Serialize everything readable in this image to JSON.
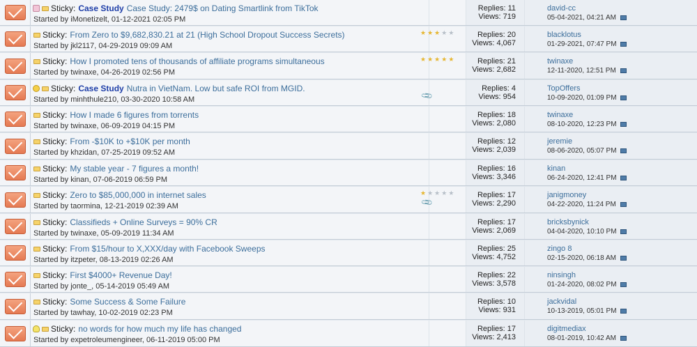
{
  "threads": [
    {
      "pre_icon": "pink",
      "sticky": "Sticky:",
      "prefix": "Case Study",
      "title": "Case Study: 2479$ on Dating Smartlink from TikTok",
      "starter": "Started by iMonetizelt, 01-12-2021 02:05 PM",
      "rating": 0,
      "attachment": false,
      "replies": "Replies: 11",
      "views": "Views: 719",
      "last_user": "david-cc",
      "last_date": "05-04-2021,",
      "last_time": "04:21 AM"
    },
    {
      "pre_icon": "",
      "sticky": "Sticky:",
      "prefix": "",
      "title": "From Zero to $9,682,830.21 at 21 (High School Dropout Success Secrets)",
      "starter": "Started by jkl2117, 04-29-2019 09:09 AM",
      "rating": 3,
      "attachment": false,
      "replies": "Replies: 20",
      "views": "Views: 4,067",
      "last_user": "blacklotus",
      "last_date": "01-29-2021,",
      "last_time": "07:47 PM"
    },
    {
      "pre_icon": "",
      "sticky": "Sticky:",
      "prefix": "",
      "title": "How I promoted tens of thousands of affiliate programs simultaneous",
      "starter": "Started by twinaxe, 04-26-2019 02:56 PM",
      "rating": 5,
      "attachment": false,
      "replies": "Replies: 21",
      "views": "Views: 2,682",
      "last_user": "twinaxe",
      "last_date": "12-11-2020,",
      "last_time": "12:51 PM"
    },
    {
      "pre_icon": "smile",
      "sticky": "Sticky:",
      "prefix": "Case Study",
      "title": "Nutra in VietNam. Low but safe ROI from MGID.",
      "starter": "Started by minhthule210, 03-30-2020 10:58 AM",
      "rating": 0,
      "attachment": true,
      "replies": "Replies: 4",
      "views": "Views: 954",
      "last_user": "TopOffers",
      "last_date": "10-09-2020,",
      "last_time": "01:09 PM"
    },
    {
      "pre_icon": "",
      "sticky": "Sticky:",
      "prefix": "",
      "title": "How I made 6 figures from torrents",
      "starter": "Started by twinaxe, 06-09-2019 04:15 PM",
      "rating": 0,
      "attachment": false,
      "replies": "Replies: 18",
      "views": "Views: 2,080",
      "last_user": "twinaxe",
      "last_date": "08-10-2020,",
      "last_time": "12:23 PM"
    },
    {
      "pre_icon": "",
      "sticky": "Sticky:",
      "prefix": "",
      "title": "From -$10K to +$10K per month",
      "starter": "Started by khzidan, 07-25-2019 09:52 AM",
      "rating": 0,
      "attachment": false,
      "replies": "Replies: 12",
      "views": "Views: 2,039",
      "last_user": "jeremie",
      "last_date": "08-06-2020,",
      "last_time": "05:07 PM"
    },
    {
      "pre_icon": "",
      "sticky": "Sticky:",
      "prefix": "",
      "title": "My stable year - 7 figures a month!",
      "starter": "Started by kinan, 07-06-2019 06:59 PM",
      "rating": 0,
      "attachment": false,
      "replies": "Replies: 16",
      "views": "Views: 3,346",
      "last_user": "kinan",
      "last_date": "06-24-2020,",
      "last_time": "12:41 PM"
    },
    {
      "pre_icon": "",
      "sticky": "Sticky:",
      "prefix": "",
      "title": "Zero to $85,000,000 in internet sales",
      "starter": "Started by taormina, 12-21-2019 02:39 AM",
      "rating": 1,
      "attachment": true,
      "replies": "Replies: 17",
      "views": "Views: 2,290",
      "last_user": "janigmoney",
      "last_date": "04-22-2020,",
      "last_time": "11:24 PM"
    },
    {
      "pre_icon": "",
      "sticky": "Sticky:",
      "prefix": "",
      "title": "Classifieds + Online Surveys = 90% CR",
      "starter": "Started by twinaxe, 05-09-2019 11:34 AM",
      "rating": 0,
      "attachment": false,
      "replies": "Replies: 17",
      "views": "Views: 2,069",
      "last_user": "bricksbynick",
      "last_date": "04-04-2020,",
      "last_time": "10:10 PM"
    },
    {
      "pre_icon": "",
      "sticky": "Sticky:",
      "prefix": "",
      "title": "From $15/hour to X,XXX/day with Facebook Sweeps",
      "starter": "Started by itzpeter, 08-13-2019 02:26 AM",
      "rating": 0,
      "attachment": false,
      "replies": "Replies: 25",
      "views": "Views: 4,752",
      "last_user": "zingo 8",
      "last_date": "02-15-2020,",
      "last_time": "06:18 AM"
    },
    {
      "pre_icon": "",
      "sticky": "Sticky:",
      "prefix": "",
      "title": "First $4000+ Revenue Day!",
      "starter": "Started by jonte_, 05-14-2019 05:49 AM",
      "rating": 0,
      "attachment": false,
      "replies": "Replies: 22",
      "views": "Views: 3,578",
      "last_user": "ninsingh",
      "last_date": "01-24-2020,",
      "last_time": "08:02 PM"
    },
    {
      "pre_icon": "",
      "sticky": "Sticky:",
      "prefix": "",
      "title": "Some Success & Some Failure",
      "starter": "Started by tawhay, 10-02-2019 02:23 PM",
      "rating": 0,
      "attachment": false,
      "replies": "Replies: 10",
      "views": "Views: 931",
      "last_user": "jackvidal",
      "last_date": "10-13-2019,",
      "last_time": "05:01 PM"
    },
    {
      "pre_icon": "bulb",
      "sticky": "Sticky:",
      "prefix": "",
      "title": "no words for how much my life has changed",
      "starter": "Started by expetroleumengineer, 06-11-2019 05:00 PM",
      "rating": 0,
      "attachment": false,
      "replies": "Replies: 17",
      "views": "Views: 2,413",
      "last_user": "digitmediax",
      "last_date": "08-01-2019,",
      "last_time": "10:42 AM"
    }
  ],
  "icons": {
    "thread_status": "envelope-icon",
    "folder": "folder-icon",
    "attachment": "paperclip-icon",
    "goto_last": "goto-last-post-icon",
    "star": "star-icon"
  },
  "colors": {
    "title_link": "#3c6e9b",
    "prefix": "#1f3fa8",
    "envelope": "#e57a53",
    "star_on": "#e6b630",
    "star_off": "#b7bfc8"
  }
}
